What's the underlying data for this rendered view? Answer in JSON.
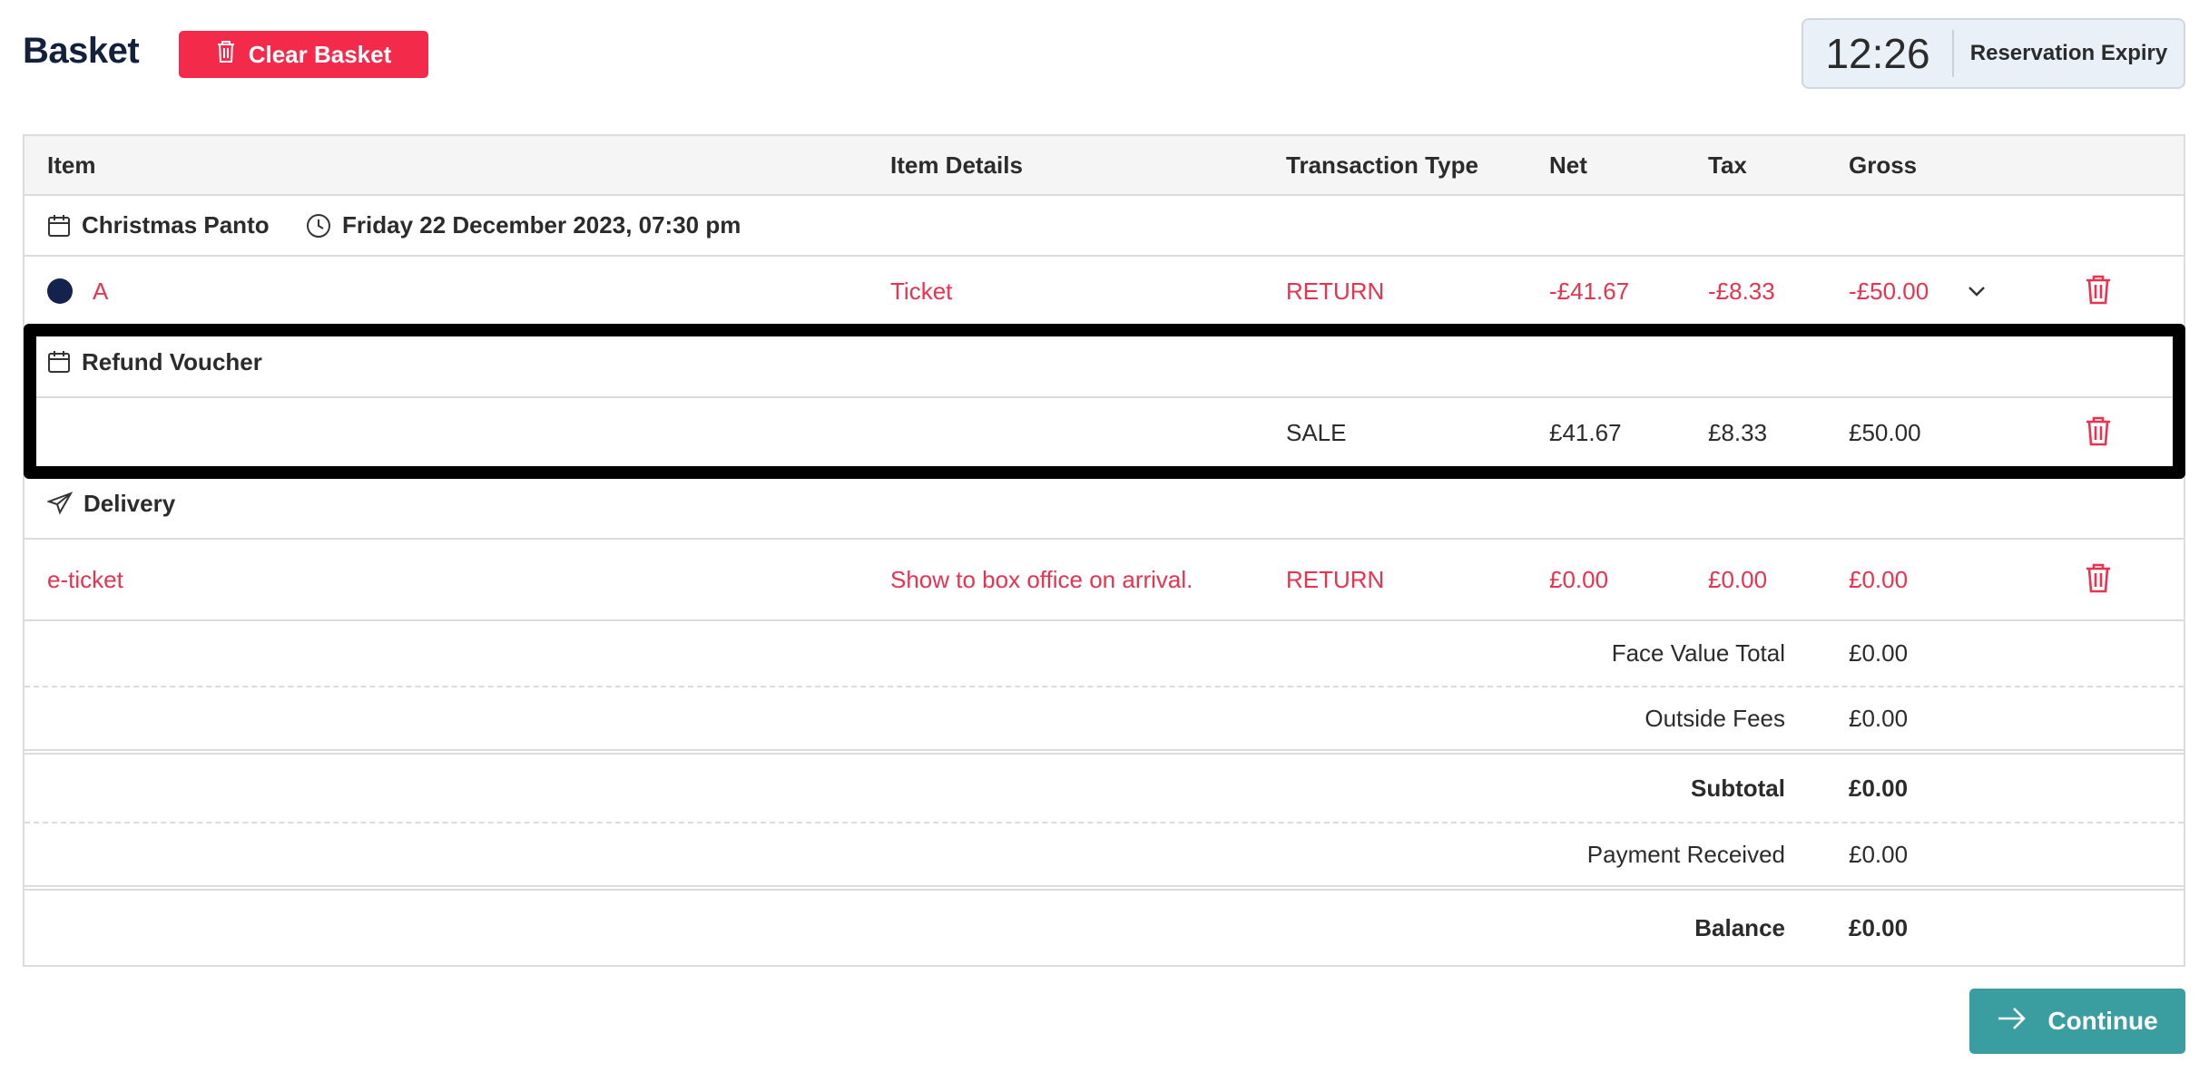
{
  "header": {
    "title": "Basket",
    "clear_label": "Clear Basket",
    "timer_value": "12:26",
    "timer_label": "Reservation Expiry"
  },
  "columns": [
    "Item",
    "Item Details",
    "Transaction Type",
    "Net",
    "Tax",
    "Gross"
  ],
  "event": {
    "name": "Christmas Panto",
    "datetime": "Friday 22 December 2023, 07:30 pm"
  },
  "ticket_line": {
    "seat": "A",
    "details": "Ticket",
    "type": "RETURN",
    "net": "-£41.67",
    "tax": "-£8.33",
    "gross": "-£50.00"
  },
  "voucher": {
    "name": "Refund Voucher",
    "type": "SALE",
    "net": "£41.67",
    "tax": "£8.33",
    "gross": "£50.00"
  },
  "delivery": {
    "name": "Delivery",
    "item": "e-ticket",
    "details": "Show to box office on arrival.",
    "type": "RETURN",
    "net": "£0.00",
    "tax": "£0.00",
    "gross": "£0.00"
  },
  "summary": {
    "face_value_label": "Face Value Total",
    "face_value": "£0.00",
    "outside_fees_label": "Outside Fees",
    "outside_fees": "£0.00",
    "subtotal_label": "Subtotal",
    "subtotal": "£0.00",
    "payment_label": "Payment Received",
    "payment": "£0.00",
    "balance_label": "Balance",
    "balance": "£0.00"
  },
  "continue_label": "Continue",
  "colors": {
    "accent_red": "#f42a4b",
    "return_red": "#e8324f",
    "continue_teal": "#3a9ea1",
    "navy": "#14213d"
  }
}
